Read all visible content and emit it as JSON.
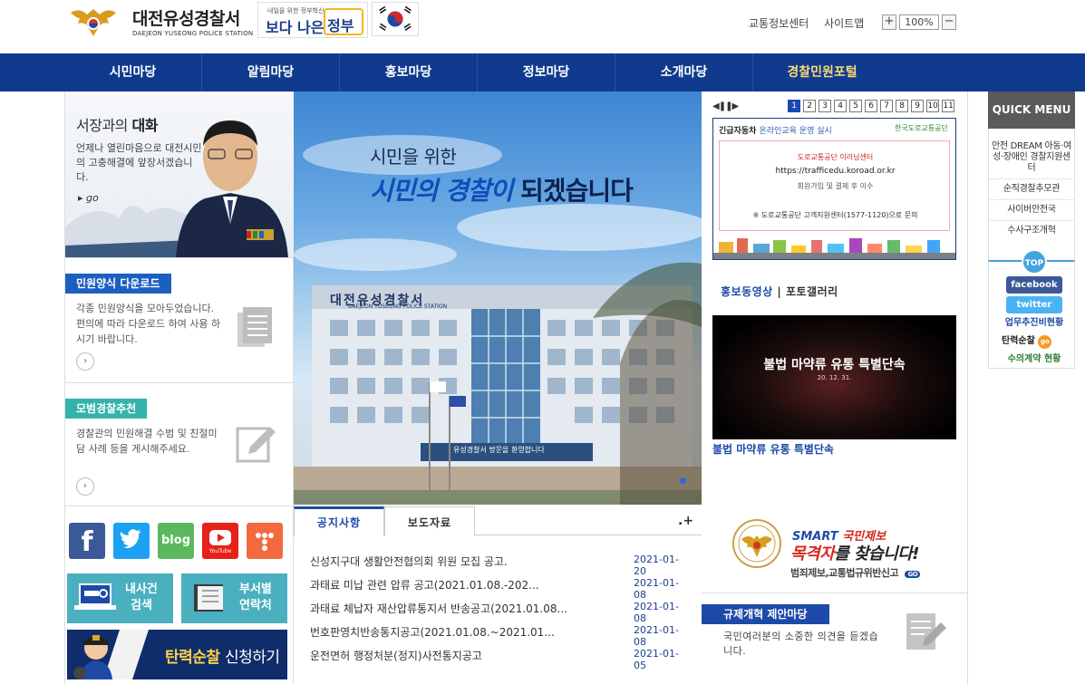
{
  "header": {
    "title": "대전유성경찰서",
    "subtitle": "DAEJEON YUSEONG POLICE STATION",
    "gov_tagline": "내일을 위한 정부혁신",
    "gov_main": "보다 나은",
    "gov_word": "정부",
    "links": [
      "교통정보센터",
      "사이트맵"
    ],
    "zoom_in": "+",
    "zoom_value": "100%",
    "zoom_out": "−"
  },
  "gnb": [
    "시민마당",
    "알림마당",
    "홍보마당",
    "정보마당",
    "소개마당",
    "경찰민원포털"
  ],
  "chief": {
    "title_a": "서장과의",
    "title_b": "대화",
    "desc": "언제나 열린마음으로 대전시민의 고충해결에 앞장서겠습니다.",
    "go": "go"
  },
  "forms": {
    "tab": "민원양식 다운로드",
    "desc": "각종 민원양식을 모아두었습니다. 편의에 따라 다운로드 하여 사용 하시기 바랍니다."
  },
  "model": {
    "tab": "모범경찰추천",
    "desc": "경찰관의 민원해결 수범 및 친절미담 사례 등을 게시해주세요."
  },
  "hero": {
    "line1": "시민을 위한",
    "line2a": "시민의 경찰이",
    "line2b": "되겠습니다",
    "building_sign": "대전유성경찰서",
    "building_sign_en": "DAEJEON YUSEONG POLICE STATION",
    "welcome": "유성경찰서 방문을 환영합니다"
  },
  "pager": {
    "pages": [
      "1",
      "2",
      "3",
      "4",
      "5",
      "6",
      "7",
      "8",
      "9",
      "10",
      "11"
    ],
    "active": "1"
  },
  "banner": {
    "head_a": "긴급자동차",
    "head_b": "온라인교육 운영 실시",
    "logo": "한국도로교통공단",
    "b1": "도로교통공단 이러닝센터",
    "b2": "https://trafficedu.koroad.or.kr",
    "b3": "회원가입 및 결제 후 이수",
    "b4": "※ 도로교통공단 고객지원센터(1577-1120)으로 문의"
  },
  "media": {
    "tab_video": "홍보동영상",
    "separator": "|",
    "tab_photo": "포토갤러리",
    "video_title": "불법 마약류 유통 특별단속",
    "video_date": "20. 12. 31.",
    "caption": "불법 마약류 유통 특별단속"
  },
  "quick": {
    "head": "QUICK MENU",
    "items": [
      "안전 DREAM 아동·여성·장애인 경찰지원센터",
      "순직경찰추모관",
      "사이버안전국",
      "수사구조개혁"
    ],
    "top": "TOP",
    "sns": [
      "facebook",
      "twitter",
      "업무추진비현황",
      "탄력순찰",
      "수의계약 현황"
    ],
    "go": "go"
  },
  "sns_links": [
    "facebook",
    "twitter",
    "blog",
    "YouTube",
    "tistory"
  ],
  "tiles": {
    "my_case_a": "내사건",
    "my_case_b": "검색",
    "dept_a": "부서별",
    "dept_b": "연락처"
  },
  "patrol": {
    "a": "탄력순찰",
    "b": "신청하기"
  },
  "notice": {
    "tab_notice": "공지사항",
    "tab_press": "보도자료",
    "more": "+",
    "rows": [
      {
        "title": "신성지구대 생활안전협의회 위원 모집 공고.",
        "date": "2021-01-20"
      },
      {
        "title": "과태료 미납 관련 압류 공고(2021.01.08.-202...",
        "date": "2021-01-08"
      },
      {
        "title": "과태료 체납자 재산압류통지서 반송공고(2021.01.08...",
        "date": "2021-01-08"
      },
      {
        "title": "번호판영치반송통지공고(2021.01.08.~2021.01...",
        "date": "2021-01-08"
      },
      {
        "title": "운전면허 행정처분(정지)사전통지공고",
        "date": "2021-01-05"
      }
    ]
  },
  "witness": {
    "l1a": "SMART",
    "l1b": "국민제보",
    "l2a": "목격자",
    "l2b": "를 찾습니다!",
    "l3": "범죄제보,교통법규위반신고",
    "go": "GO"
  },
  "reform": {
    "tab": "규제개혁 제안마당",
    "desc": "국민여러분의 소중한 의견을 듣겠습니다."
  },
  "colors": {
    "primary": "#0f3a8e",
    "accent_blue": "#1d4aa8",
    "teal": "#4ab0c0",
    "gold": "#fbd77a"
  }
}
